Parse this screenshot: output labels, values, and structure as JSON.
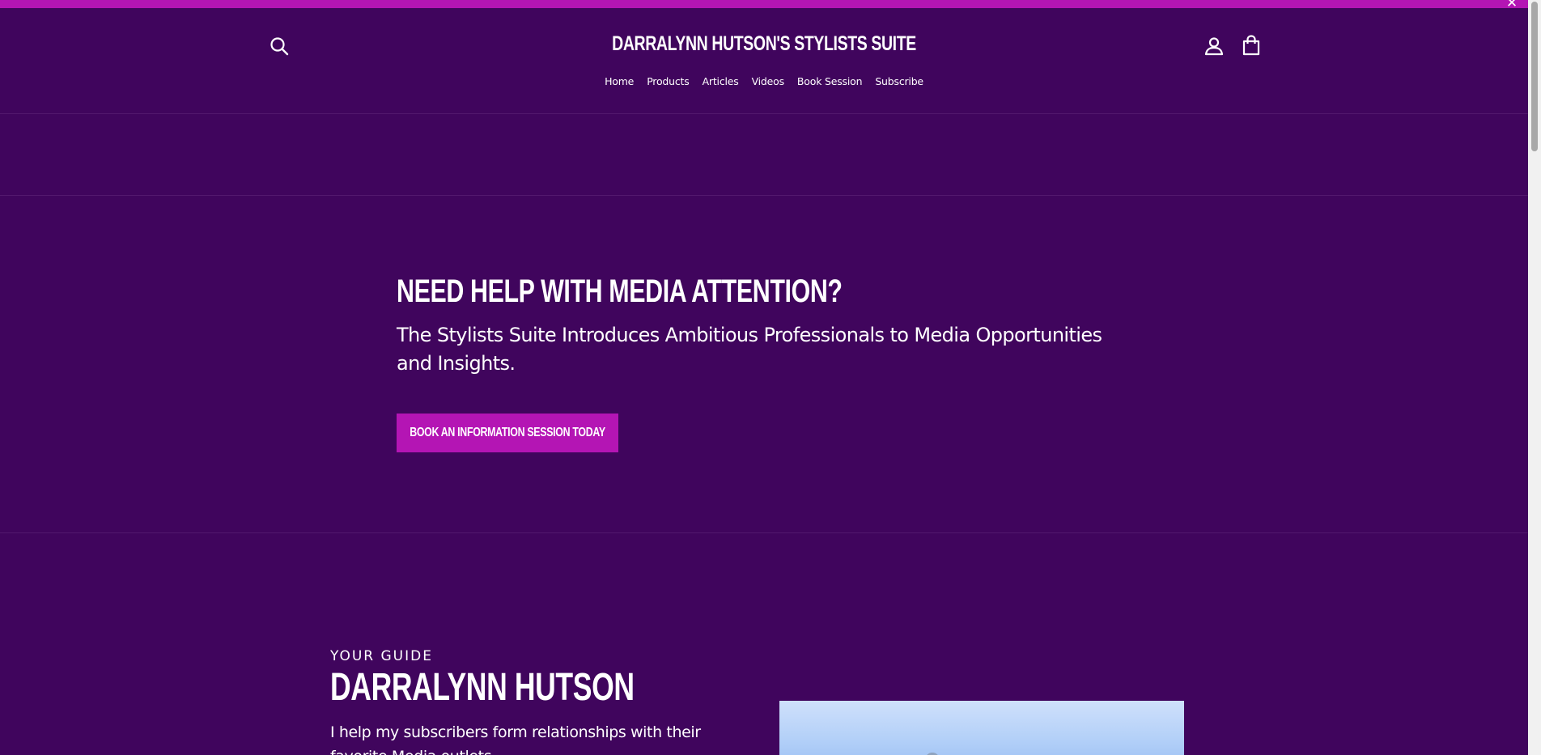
{
  "announcement": {
    "close_label": "✕"
  },
  "header": {
    "site_title": "DARRALYNN HUTSON'S STYLISTS SUITE",
    "search_icon": "search-icon",
    "account_icon": "account-icon",
    "cart_icon": "cart-icon",
    "nav": [
      {
        "label": "Home"
      },
      {
        "label": "Products"
      },
      {
        "label": "Articles"
      },
      {
        "label": "Videos"
      },
      {
        "label": "Book Session"
      },
      {
        "label": "Subscribe"
      }
    ]
  },
  "hero": {
    "title": "NEED HELP WITH MEDIA ATTENTION?",
    "subtitle": "The Stylists Suite Introduces Ambitious Professionals to Media Opportunities and Insights.",
    "cta_label": "BOOK AN INFORMATION SESSION TODAY"
  },
  "guide": {
    "eyebrow": "YOUR GUIDE",
    "name": "DARRALYNN HUTSON",
    "text": "I help my subscribers form relationships with their favorite Media outlets."
  },
  "colors": {
    "background": "#40055d",
    "accent": "#b415b4",
    "text": "#ffffff"
  }
}
